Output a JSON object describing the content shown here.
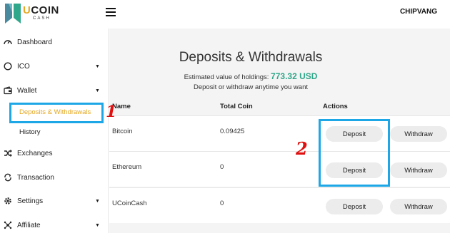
{
  "brand": {
    "name_part1": "U",
    "name_part2": "COIN",
    "name_sub": "CASH"
  },
  "header": {
    "username": "CHIPVANG"
  },
  "sidebar": {
    "items": [
      {
        "label": "Dashboard",
        "icon": "dashboard-icon"
      },
      {
        "label": "ICO",
        "icon": "coin-icon",
        "caret": "▼"
      },
      {
        "label": "Wallet",
        "icon": "wallet-icon",
        "caret": "▼"
      },
      {
        "label": "Deposits & Withdrawals"
      },
      {
        "label": "History"
      },
      {
        "label": "Exchanges",
        "icon": "shuffle-icon"
      },
      {
        "label": "Transaction",
        "icon": "transaction-icon"
      },
      {
        "label": "Settings",
        "icon": "gear-icon",
        "caret": "▼"
      },
      {
        "label": "Affiliate",
        "icon": "network-icon",
        "caret": "▼"
      }
    ]
  },
  "main": {
    "title": "Deposits & Withdrawals",
    "estimated_label": "Estimated value of holdings:",
    "estimated_value": "773.32 USD",
    "subtitle2": "Deposit or withdraw anytime you want",
    "columns": [
      "Name",
      "Total Coin",
      "Actions"
    ],
    "rows": [
      {
        "name": "Bitcoin",
        "total": "0.09425",
        "deposit": "Deposit",
        "withdraw": "Withdraw"
      },
      {
        "name": "Ethereum",
        "total": "0",
        "deposit": "Deposit",
        "withdraw": "Withdraw"
      },
      {
        "name": "UCoinCash",
        "total": "0",
        "deposit": "Deposit",
        "withdraw": "Withdraw"
      }
    ]
  },
  "annotations": {
    "one": "1",
    "two": "2"
  },
  "colors": {
    "accent_value": "#2fa78a",
    "highlight": "#1ea7e6",
    "annotation": "#e01010",
    "active_link": "#e5a823"
  }
}
